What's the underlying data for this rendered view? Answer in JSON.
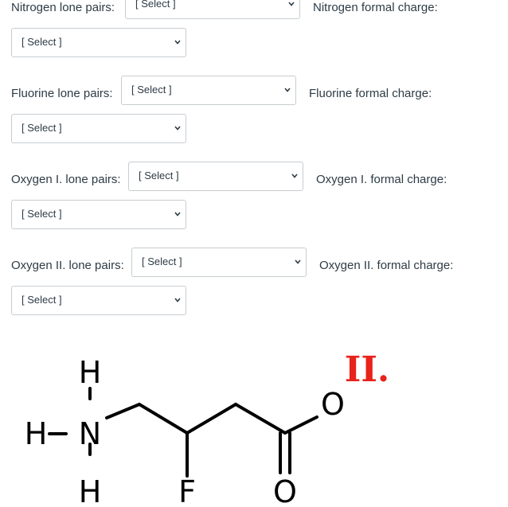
{
  "rows": [
    {
      "lone_label": "Nitrogen lone pairs:",
      "lone_select": "[ Select ]",
      "charge_label": "Nitrogen formal charge:",
      "charge_select": "[ Select ]"
    },
    {
      "lone_label": "Fluorine lone pairs:",
      "lone_select": "[ Select ]",
      "charge_label": "Fluorine formal charge:",
      "charge_select": "[ Select ]"
    },
    {
      "lone_label": "Oxygen I. lone pairs:",
      "lone_select": "[ Select ]",
      "charge_label": "Oxygen I. formal charge:",
      "charge_select": "[ Select ]"
    },
    {
      "lone_label": "Oxygen II. lone pairs:",
      "lone_select": "[ Select ]",
      "charge_label": "Oxygen II. formal charge:",
      "charge_select": "[ Select ]"
    }
  ],
  "molecule": {
    "atom_h_top": "H",
    "atom_h_left": "H",
    "atom_n": "N",
    "atom_h_bottom": "H",
    "atom_f": "F",
    "atom_o_ester": "O",
    "atom_o_carbonyl": "O",
    "oxygen_marker": "II.",
    "marker_color": "#e8231b"
  }
}
